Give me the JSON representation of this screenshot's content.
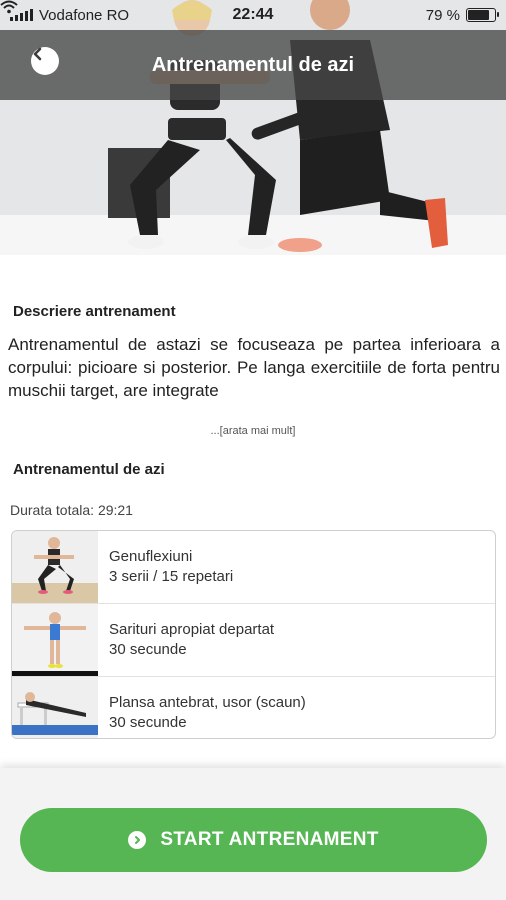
{
  "status_bar": {
    "carrier": "Vodafone RO",
    "time": "22:44",
    "battery_percent": "79 %",
    "battery_level": 0.79,
    "icons": [
      "signal-icon",
      "wifi-icon",
      "battery-icon"
    ]
  },
  "header": {
    "title": "Antrenamentul de azi",
    "back_icon": "chevron-left-icon"
  },
  "description": {
    "heading": "Descriere antrenament",
    "text": "Antrenamentul de astazi se focuseaza pe partea inferioara a corpului: picioare si posterior.  Pe langa exercitiile de forta pentru muschii target, are integrate",
    "more_label": "...[arata mai mult]"
  },
  "workout": {
    "heading": "Antrenamentul de azi",
    "duration": "Durata totala: 29:21",
    "exercises": [
      {
        "name": "Genuflexiuni",
        "detail": "3 serii / 15 repetari"
      },
      {
        "name": "Sarituri apropiat departat",
        "detail": "30 secunde"
      },
      {
        "name": "Plansa antebrat, usor (scaun)",
        "detail": "30 secunde"
      }
    ]
  },
  "start_button": {
    "label": "START ANTRENAMENT",
    "icon": "play-circle-icon"
  },
  "colors": {
    "accent": "#55b653",
    "header_overlay": "#464646"
  }
}
